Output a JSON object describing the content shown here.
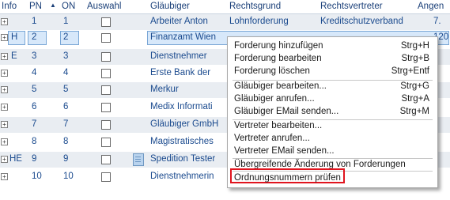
{
  "columns": {
    "info": "Info",
    "pn": "PN",
    "on": "ON",
    "auswahl": "Auswahl",
    "glaeubiger": "Gläubiger",
    "rechtsgrund": "Rechtsgrund",
    "rechtsvertreter": "Rechtsvertreter",
    "angen": "Angen"
  },
  "rows": [
    {
      "info": "",
      "pn": "1",
      "on": "1",
      "glaeubiger": "Arbeiter Anton",
      "rechtsgrund": "Lohnforderung",
      "rechtsvertreter": "Kreditschutzverband",
      "angen": "7."
    },
    {
      "info": "H",
      "pn": "2",
      "on": "2",
      "glaeubiger": "Finanzamt Wien",
      "rechtsgrund": "",
      "rechtsvertreter": "",
      "angen": "120"
    },
    {
      "info": "E",
      "pn": "3",
      "on": "3",
      "glaeubiger": "Dienstnehmer",
      "rechtsgrund": "",
      "rechtsvertreter": "",
      "angen": ""
    },
    {
      "info": "",
      "pn": "4",
      "on": "4",
      "glaeubiger": "Erste Bank der",
      "rechtsgrund": "",
      "rechtsvertreter": "",
      "angen": ""
    },
    {
      "info": "",
      "pn": "5",
      "on": "5",
      "glaeubiger": "Merkur",
      "rechtsgrund": "",
      "rechtsvertreter": "",
      "angen": ""
    },
    {
      "info": "",
      "pn": "6",
      "on": "6",
      "glaeubiger": "Medix Informati",
      "rechtsgrund": "",
      "rechtsvertreter": "",
      "angen": ""
    },
    {
      "info": "",
      "pn": "7",
      "on": "7",
      "glaeubiger": "Gläubiger GmbH",
      "rechtsgrund": "",
      "rechtsvertreter": "",
      "angen": ""
    },
    {
      "info": "",
      "pn": "8",
      "on": "8",
      "glaeubiger": "Magistratisches",
      "rechtsgrund": "",
      "rechtsvertreter": "",
      "angen": ""
    },
    {
      "info": "HE",
      "pn": "9",
      "on": "9",
      "glaeubiger": "Spedition Tester",
      "rechtsgrund": "",
      "rechtsvertreter": "",
      "angen": ""
    },
    {
      "info": "",
      "pn": "10",
      "on": "10",
      "glaeubiger": "Dienstnehmerin",
      "rechtsgrund": "",
      "rechtsvertreter": "",
      "angen": ""
    }
  ],
  "menu": {
    "items": [
      {
        "label": "Forderung hinzufügen",
        "shortcut": "Strg+H"
      },
      {
        "label": "Forderung bearbeiten",
        "shortcut": "Strg+B"
      },
      {
        "label": "Forderung löschen",
        "shortcut": "Strg+Entf"
      },
      {
        "label": "Gläubiger bearbeiten...",
        "shortcut": "Strg+G"
      },
      {
        "label": "Gläubiger anrufen...",
        "shortcut": "Strg+A"
      },
      {
        "label": "Gläubiger EMail senden...",
        "shortcut": "Strg+M"
      },
      {
        "label": "Vertreter bearbeiten...",
        "shortcut": ""
      },
      {
        "label": "Vertreter anrufen...",
        "shortcut": ""
      },
      {
        "label": "Vertreter EMail senden...",
        "shortcut": ""
      },
      {
        "label": "Übergreifende Änderung von Forderungen",
        "shortcut": ""
      },
      {
        "label": "Ordnungsnummern prüfen",
        "shortcut": ""
      }
    ]
  },
  "colors": {
    "header_text": "#1a3f78",
    "row_alt": "#e9edf2",
    "highlight_border": "#e0141e",
    "selection": "#d7e8fa"
  },
  "icons": {
    "expand": "plus-box-icon",
    "sort": "sort-up-icon",
    "document": "document-icon"
  }
}
